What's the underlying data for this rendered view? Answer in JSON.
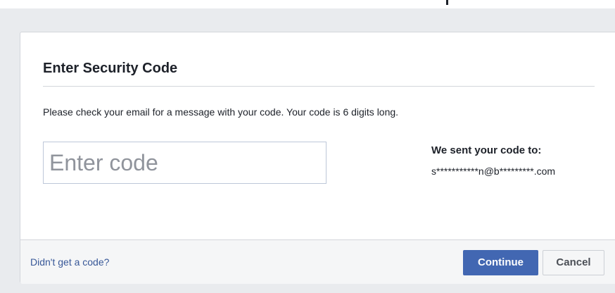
{
  "dialog": {
    "title": "Enter Security Code",
    "instructions": "Please check your email for a message with your code. Your code is 6 digits long.",
    "code_input": {
      "value": "",
      "placeholder": "Enter code"
    },
    "sent_to": {
      "label": "We sent your code to:",
      "email": "s***********n@b*********.com"
    },
    "footer": {
      "help_link": "Didn't get a code?",
      "continue_label": "Continue",
      "cancel_label": "Cancel"
    }
  },
  "colors": {
    "page_background": "#e9ebee",
    "primary_button": "#4267b2",
    "link": "#385898",
    "text": "#1d2129"
  }
}
